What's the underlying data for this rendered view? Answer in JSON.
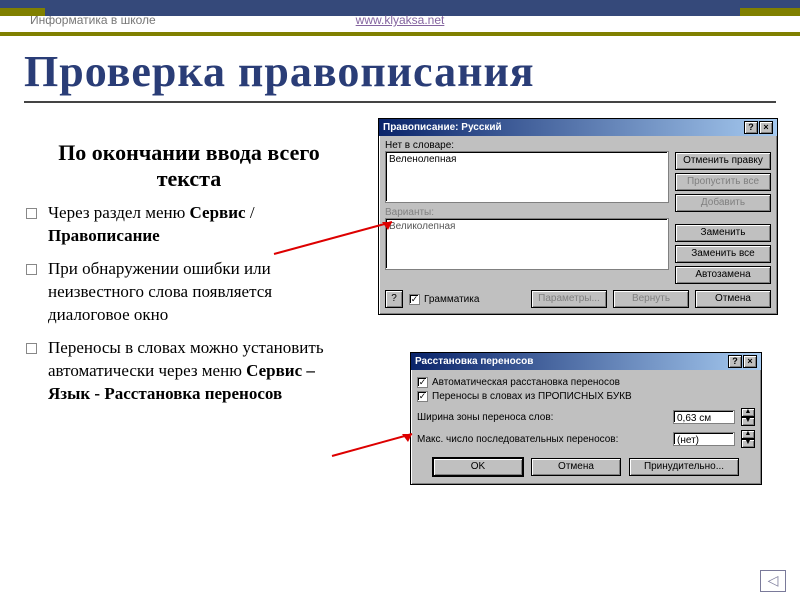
{
  "header": {
    "left": "Информатика в школе",
    "site": "www.klyaksa.net"
  },
  "title": "Проверка правописания",
  "subhead": "По окончании ввода всего текста",
  "bullets": [
    {
      "pre": "Через раздел меню ",
      "bold1": "Сервис",
      "mid": " / ",
      "bold2": "Правописание"
    },
    {
      "text": "При обнаружении ошибки или неизвестного слова появляется диалоговое окно"
    },
    {
      "pre": "Переносы в словах можно установить автоматически через меню ",
      "bold1": "Сервис – Язык - Расстановка переносов"
    }
  ],
  "dlg1": {
    "title": "Правописание: Русский",
    "help": "?",
    "close": "×",
    "lbl_notindict": "Нет в словаре:",
    "input_word": "Веленолепная",
    "lbl_variants": "Варианты:",
    "variant": "Великолепная",
    "btn_undo": "Отменить правку",
    "btn_skip": "Пропустить все",
    "btn_add": "Добавить",
    "btn_replace": "Заменить",
    "btn_replace_all": "Заменить все",
    "btn_auto": "Автозамена",
    "chk_grammar": "Грамматика",
    "btn_params": "Параметры...",
    "btn_revert": "Вернуть",
    "btn_cancel": "Отмена",
    "qmark": "?"
  },
  "dlg2": {
    "title": "Расстановка переносов",
    "help": "?",
    "close": "×",
    "chk_auto": "Автоматическая расстановка переносов",
    "chk_caps": "Переносы в словах из ПРОПИСНЫХ БУКВ",
    "lbl_zone": "Ширина зоны переноса слов:",
    "val_zone": "0,63 см",
    "lbl_max": "Макс. число последовательных переносов:",
    "val_max": "(нет)",
    "btn_ok": "OK",
    "btn_cancel": "Отмена",
    "btn_force": "Принудительно..."
  },
  "nav_back": "◁"
}
